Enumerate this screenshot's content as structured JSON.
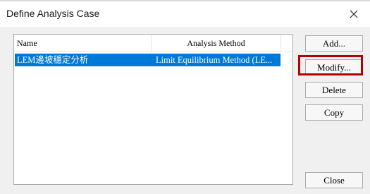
{
  "window": {
    "title": "Define Analysis Case",
    "close_icon": "close-icon"
  },
  "list": {
    "columns": [
      "Name",
      "Analysis Method"
    ],
    "rows": [
      {
        "name": "LEM邊坡穩定分析",
        "method": "Limit Equilibrium Method (LE...",
        "selected": true
      }
    ]
  },
  "buttons": {
    "add": "Add...",
    "modify": "Modify...",
    "delete": "Delete",
    "copy": "Copy",
    "close": "Close"
  },
  "colors": {
    "selection": "#0078d7",
    "highlight_box": "#b30000"
  }
}
